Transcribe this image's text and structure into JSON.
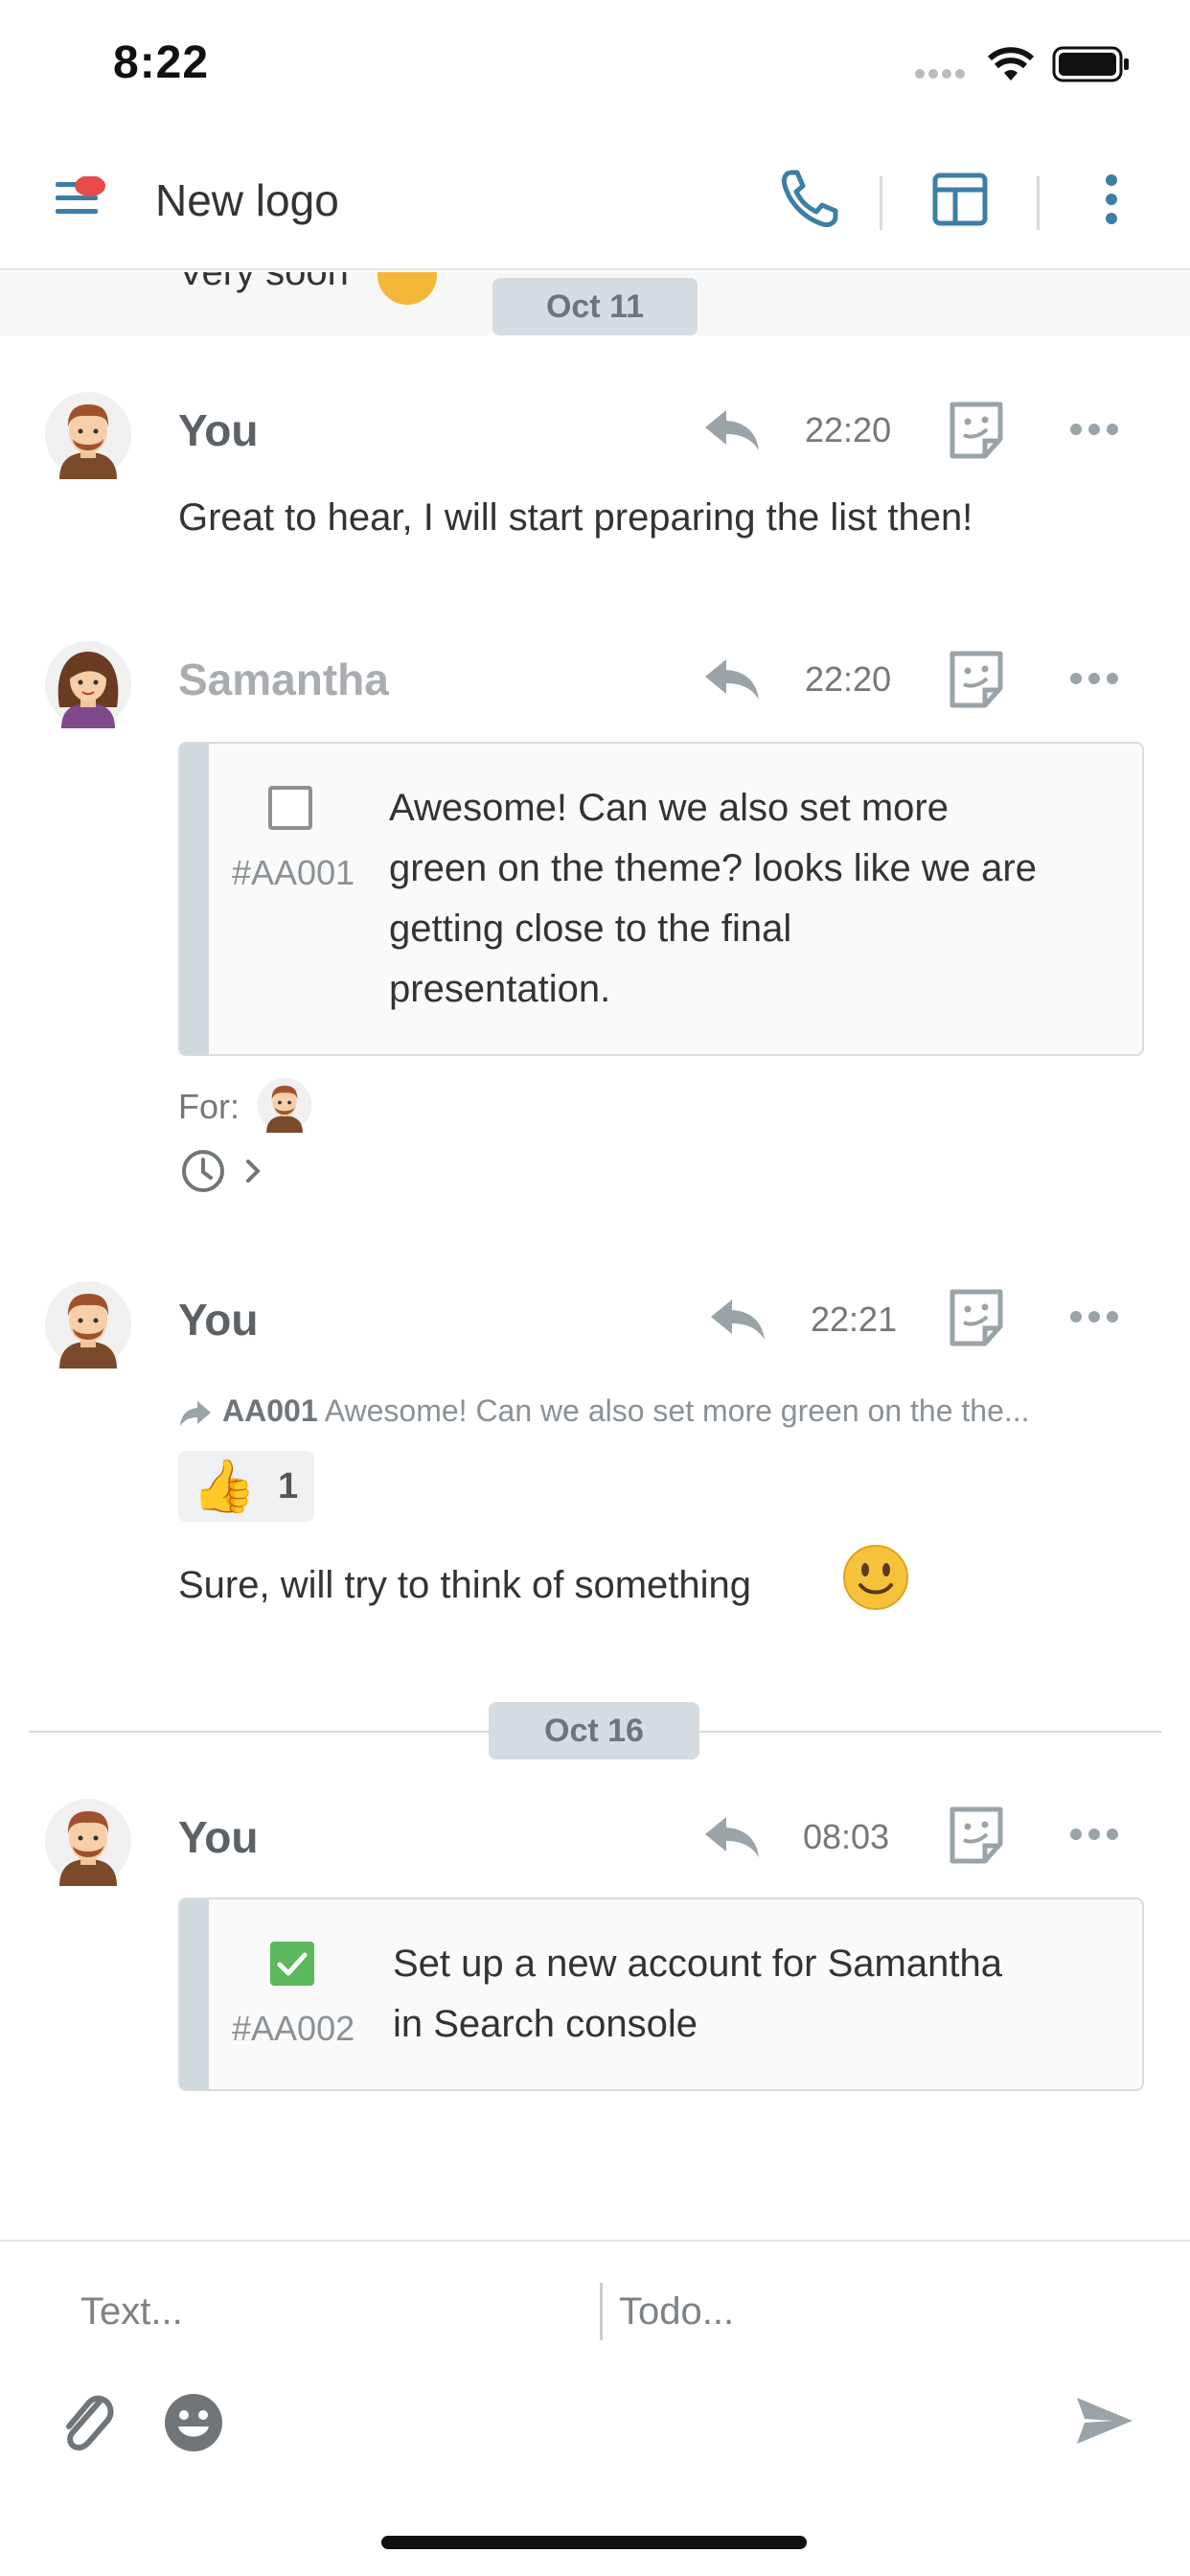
{
  "status_bar": {
    "time": "8:22"
  },
  "header": {
    "title": "New logo"
  },
  "prev_message_fragment": "Very soon",
  "date_separators": [
    "Oct 11",
    "Oct 16"
  ],
  "messages": [
    {
      "sender": "You",
      "time": "22:20",
      "text": "Great to hear, I will start preparing the list then!"
    },
    {
      "sender": "Samantha",
      "time": "22:20",
      "todo": {
        "id": "#AA001",
        "checked": false,
        "lines": [
          "Awesome! Can we also set more",
          "green on the theme? looks like we are",
          "getting close to the final",
          "presentation."
        ]
      },
      "for_label": "For:"
    },
    {
      "sender": "You",
      "time": "22:21",
      "reply_to": {
        "id": "AA001",
        "snippet": "Awesome! Can we also set more green on the the..."
      },
      "reaction": {
        "emoji": "👍",
        "count": "1"
      },
      "text": "Sure, will try to think of something"
    },
    {
      "sender": "You",
      "time": "08:03",
      "todo": {
        "id": "#AA002",
        "checked": true,
        "lines": [
          "Set up a new account for Samantha",
          "in Search console"
        ]
      }
    }
  ],
  "composer": {
    "text_placeholder": "Text...",
    "todo_placeholder": "Todo..."
  },
  "colors": {
    "accent": "#3d7ea6",
    "notification": "#e84a4a",
    "check_green": "#5cb85c",
    "date_chip": "#d4dce1"
  }
}
